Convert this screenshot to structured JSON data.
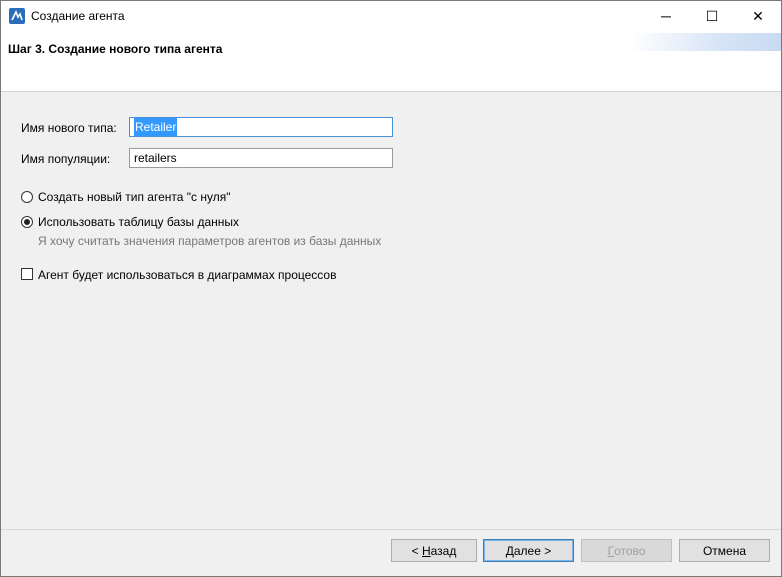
{
  "window": {
    "title": "Создание агента",
    "icon": "anylogic-icon",
    "controls": {
      "minimize": "─",
      "maximize": "☐",
      "close": "✕"
    }
  },
  "header": {
    "step_title": "Шаг 3. Создание нового типа агента"
  },
  "form": {
    "type_name_label": "Имя нового типа:",
    "type_name_value": "Retailer",
    "population_label": "Имя популяции:",
    "population_value": "retailers",
    "options": [
      {
        "label": "Создать новый тип агента \"с нуля\"",
        "selected": false
      },
      {
        "label": "Использовать таблицу базы данных",
        "selected": true,
        "hint": "Я хочу считать значения параметров агентов из базы данных"
      }
    ],
    "process_checkbox_label": "Агент будет использоваться в диаграммах процессов",
    "process_checkbox_checked": false
  },
  "footer": {
    "back_prefix": "< ",
    "back_mnemonic": "Н",
    "back_rest": "азад",
    "next_mnemonic": "Д",
    "next_rest": "алее >",
    "finish_mnemonic": "Г",
    "finish_rest": "отово",
    "cancel_label": "Отмена"
  },
  "colors": {
    "selection": "#3399ff",
    "focus_border": "#4a8fd8",
    "hint_text": "#777777"
  }
}
